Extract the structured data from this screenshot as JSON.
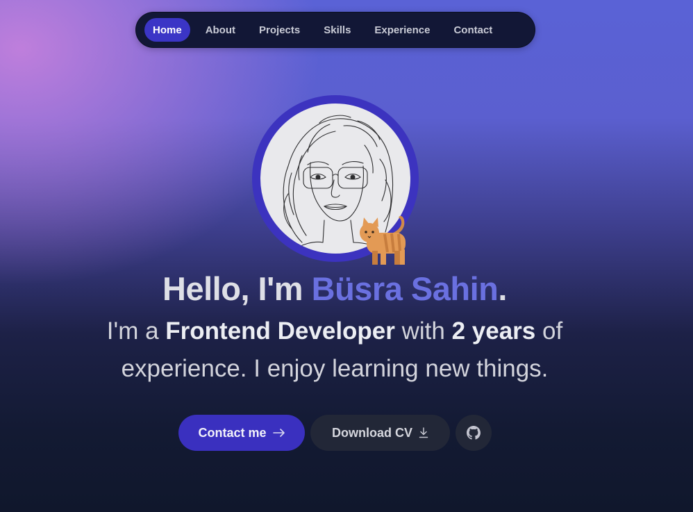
{
  "nav": {
    "items": [
      {
        "label": "Home",
        "active": true
      },
      {
        "label": "About",
        "active": false
      },
      {
        "label": "Projects",
        "active": false
      },
      {
        "label": "Skills",
        "active": false
      },
      {
        "label": "Experience",
        "active": false
      },
      {
        "label": "Contact",
        "active": false
      }
    ]
  },
  "hero": {
    "greeting": "Hello, I'm ",
    "name": "Büsra Sahin",
    "greeting_end": ".",
    "intro_1": "I'm a ",
    "role": "Frontend Developer",
    "intro_2": " with ",
    "years": "2 years",
    "intro_3": " of experience. I enjoy learning new things."
  },
  "buttons": {
    "contact": "Contact me",
    "download_cv": "Download CV"
  },
  "icons": {
    "contact": "arrow-right-icon",
    "download": "download-icon",
    "github": "github-icon",
    "avatar": "line-art-portrait",
    "mascot": "cat-icon"
  },
  "colors": {
    "accent": "#3b35c6",
    "name": "#6a70e0",
    "avatar_ring": "#3c33bf",
    "button_dark": "#222737"
  }
}
